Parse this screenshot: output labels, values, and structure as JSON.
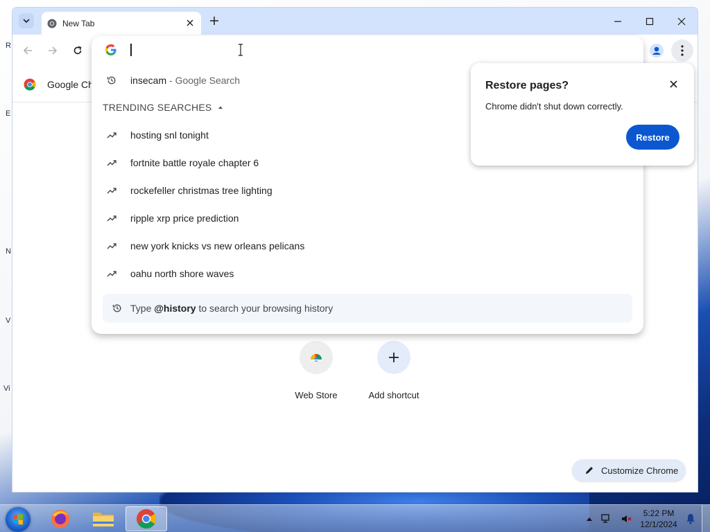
{
  "browser": {
    "tab": {
      "title": "New Tab"
    },
    "bookmarks": [
      {
        "label": "Google Ch"
      }
    ]
  },
  "omnibox": {
    "input_value": "",
    "history_suggestion": {
      "query": "insecam",
      "suffix": "- Google Search"
    },
    "trending_label": "TRENDING SEARCHES",
    "trending": [
      "hosting snl tonight",
      "fortnite battle royale chapter 6",
      "rockefeller christmas tree lighting",
      "ripple xrp price prediction",
      "new york knicks vs new orleans pelicans",
      "oahu north shore waves"
    ],
    "history_hint": {
      "prefix": "Type",
      "keyword": "@history",
      "suffix": "to search your browsing history"
    }
  },
  "restore_popup": {
    "title": "Restore pages?",
    "message": "Chrome didn't shut down correctly.",
    "button": "Restore"
  },
  "shortcuts": [
    {
      "label": "Web Store",
      "icon": "chrome-web-store-icon"
    },
    {
      "label": "Add shortcut",
      "icon": "plus-icon"
    }
  ],
  "customize": {
    "label": "Customize Chrome"
  },
  "taskbar": {
    "apps": [
      "firefox-icon",
      "file-explorer-icon",
      "chrome-icon"
    ],
    "time": "5:22 PM",
    "date": "12/1/2024"
  },
  "desktop_letters": [
    "R",
    "E",
    "N",
    "V",
    "Vi"
  ],
  "colors": {
    "accent": "#0b57d0",
    "titlebar": "#d3e3fd",
    "customize_bg": "#e3ebf8"
  }
}
